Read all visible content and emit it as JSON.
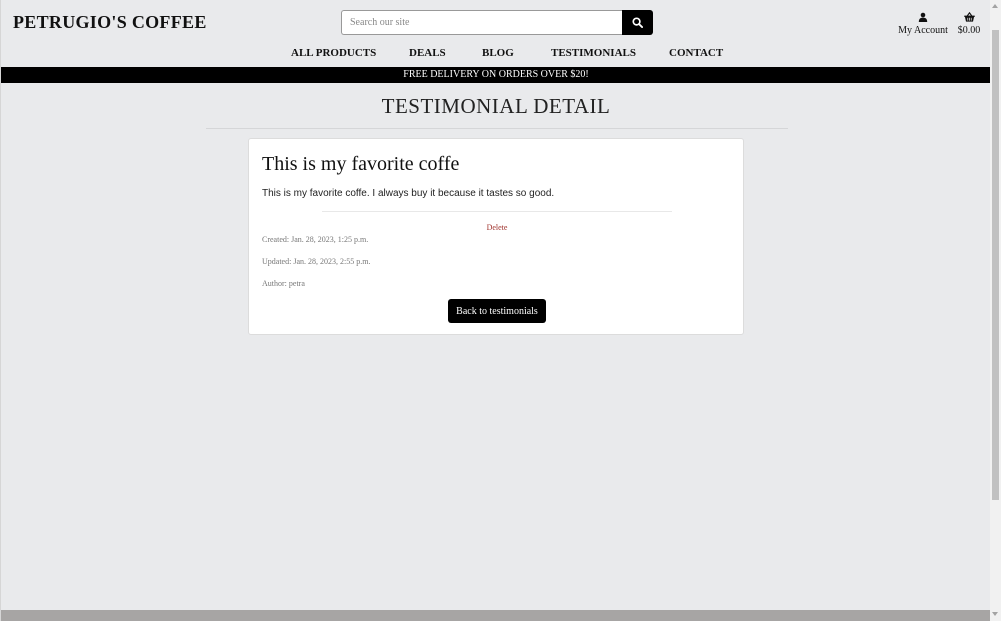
{
  "header": {
    "brand": "PETRUGIO'S COFFEE",
    "search_placeholder": "Search our site",
    "account_label": "My Account",
    "bag_total": "$0.00"
  },
  "nav": {
    "items": [
      "ALL PRODUCTS",
      "DEALS",
      "BLOG",
      "TESTIMONIALS",
      "CONTACT"
    ]
  },
  "banner": "FREE DELIVERY ON ORDERS OVER $20!",
  "page": {
    "heading": "TESTIMONIAL DETAIL"
  },
  "testimonial": {
    "title": "This is my favorite coffe",
    "body": "This is my favorite coffe. I always buy it because it tastes so good.",
    "delete_label": "Delete",
    "created": "Created: Jan. 28, 2023, 1:25 p.m.",
    "updated": "Updated: Jan. 28, 2023, 2:55 p.m.",
    "author": "Author: petra",
    "back_label": "Back to testimonials"
  },
  "colors": {
    "accent": "#000000",
    "background": "#e9eaec",
    "delete": "#a0322c"
  }
}
